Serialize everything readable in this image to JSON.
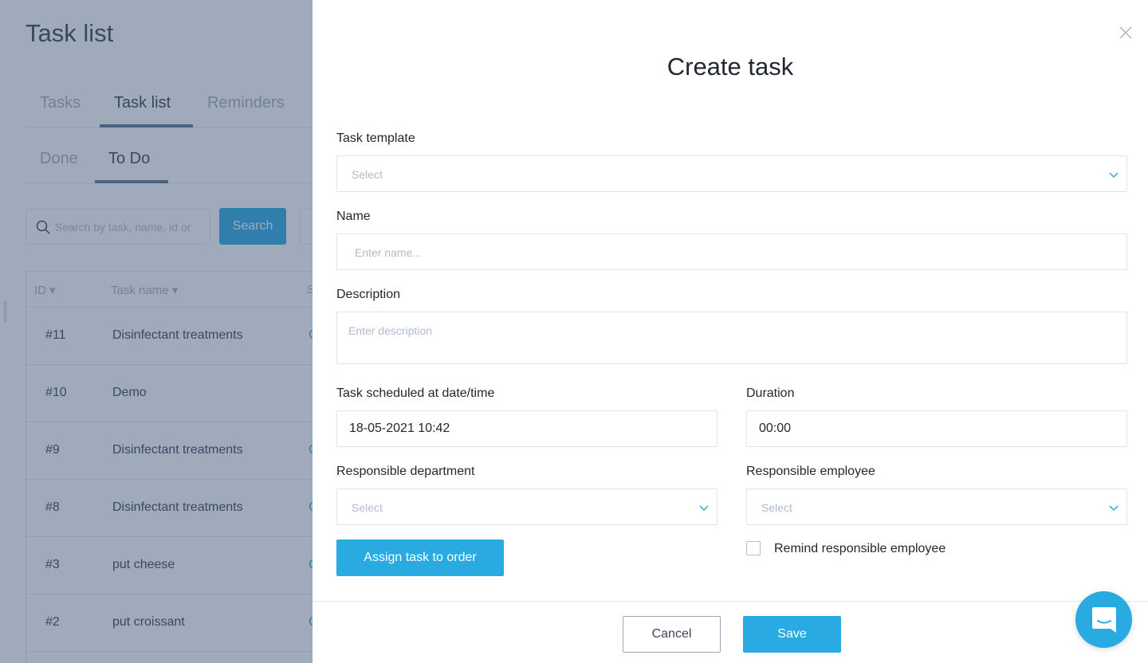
{
  "background": {
    "title": "Task list",
    "tabs": [
      {
        "label": "Tasks",
        "active": false
      },
      {
        "label": "Task list",
        "active": true
      },
      {
        "label": "Reminders",
        "active": false
      }
    ],
    "subtabs": [
      {
        "label": "Done",
        "active": false
      },
      {
        "label": "To Do",
        "active": true
      }
    ],
    "search": {
      "placeholder": "Search by task, name, id or",
      "button_label": "Search"
    },
    "table": {
      "columns": [
        "ID",
        "Task name",
        "S"
      ],
      "rows": [
        {
          "id": "#11",
          "name": "Disinfectant treatments",
          "status": "C"
        },
        {
          "id": "#10",
          "name": "Demo",
          "status": ""
        },
        {
          "id": "#9",
          "name": "Disinfectant treatments",
          "status": "C"
        },
        {
          "id": "#8",
          "name": "Disinfectant treatments",
          "status": "C"
        },
        {
          "id": "#3",
          "name": "put cheese",
          "status": "C"
        },
        {
          "id": "#2",
          "name": "put croissant",
          "status": "C"
        }
      ]
    }
  },
  "drawer": {
    "title": "Create task",
    "close_icon": "close-icon",
    "fields": {
      "task_template": {
        "label": "Task template",
        "placeholder": "Select"
      },
      "name": {
        "label": "Name",
        "placeholder": "Enter name..."
      },
      "description": {
        "label": "Description",
        "placeholder": "Enter description"
      },
      "scheduled": {
        "label": "Task scheduled at date/time",
        "value": "18-05-2021 10:42"
      },
      "duration": {
        "label": "Duration",
        "value": "00:00"
      },
      "department": {
        "label": "Responsible department",
        "placeholder": "Select"
      },
      "employee": {
        "label": "Responsible employee",
        "placeholder": "Select"
      }
    },
    "assign_button": "Assign task to order",
    "remind_checkbox": {
      "label": "Remind responsible employee",
      "checked": false
    },
    "cancel_button": "Cancel",
    "save_button": "Save"
  },
  "colors": {
    "accent": "#29abe2",
    "text_dark": "#222831",
    "placeholder": "#b1bccc",
    "overlay": "#374e71"
  },
  "chat_widget": {
    "icon": "chat-bubble-smile-icon"
  }
}
